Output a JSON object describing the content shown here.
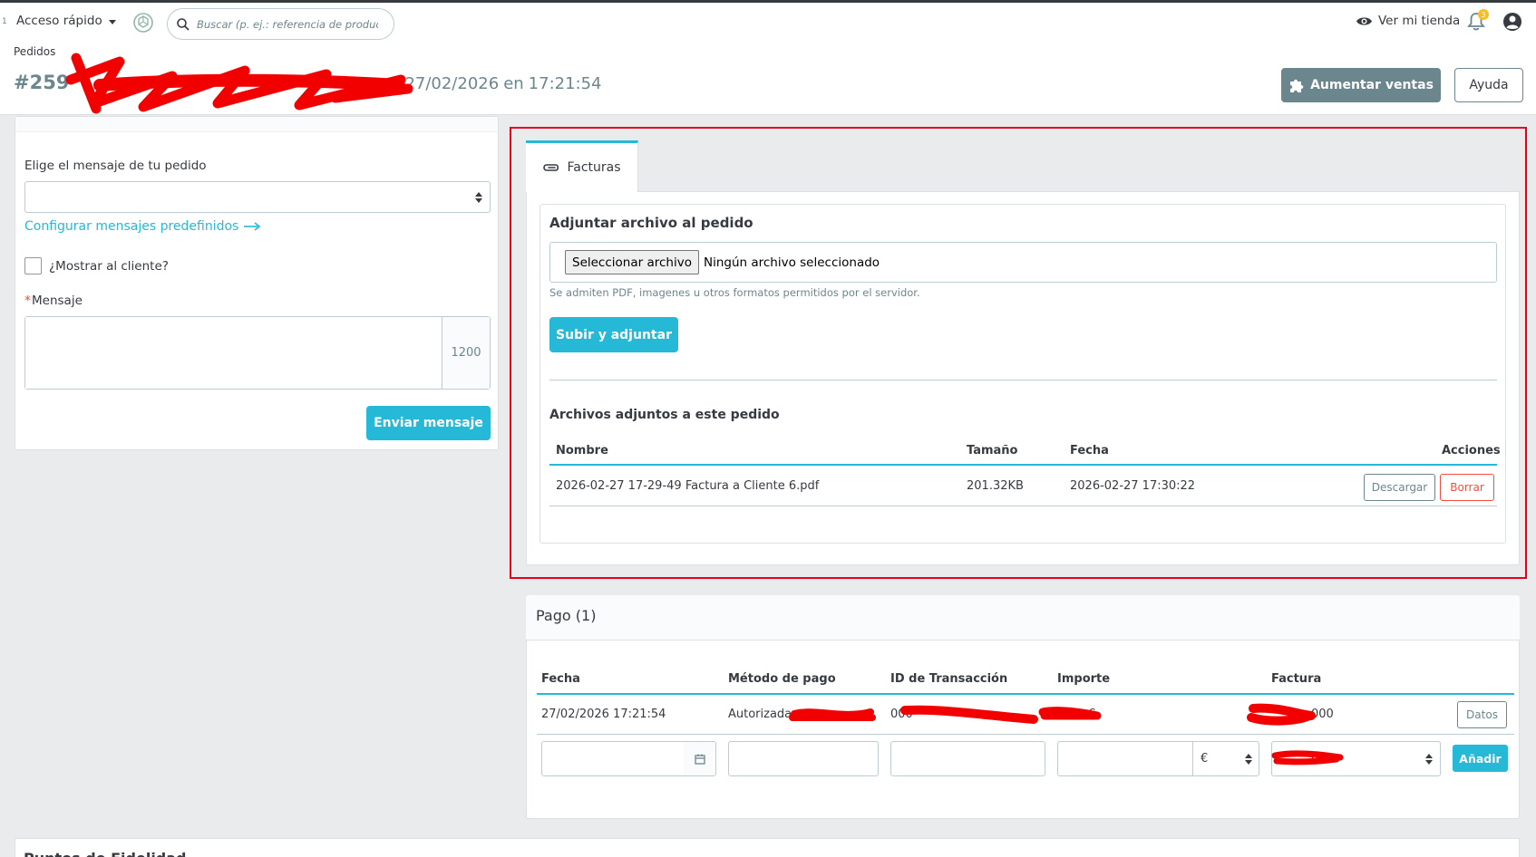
{
  "header": {
    "number_one": "1",
    "quick_access": "Acceso rápido",
    "search_placeholder": "Buscar (p. ej.: referencia de producto,",
    "view_store": "Ver mi tienda",
    "notification_count": "3"
  },
  "breadcrumb": "Pedidos",
  "order": {
    "number": "#259",
    "date": "27/02/2026",
    "at": "en",
    "time": "17:21:54"
  },
  "toolbar": {
    "grow_sales": "Aumentar ventas",
    "help": "Ayuda"
  },
  "messages": {
    "choose_label": "Elige el mensaje de tu pedido",
    "config_link": "Configurar mensajes predefinidos",
    "show_customer": "¿Mostrar al cliente?",
    "required_mark": "*",
    "message_label": "Mensaje",
    "char_count": "1200",
    "send_button": "Enviar mensaje"
  },
  "attachments": {
    "tab_label": "Facturas",
    "title": "Adjuntar archivo al pedido",
    "file_button": "Seleccionar archivo",
    "file_none": "Ningún archivo seleccionado",
    "help": "Se admiten PDF, imagenes u otros formatos permitidos por el servidor.",
    "upload_button": "Subir y adjuntar",
    "list_title": "Archivos adjuntos a este pedido",
    "columns": [
      "Nombre",
      "Tamaño",
      "Fecha",
      "Acciones"
    ],
    "rows": [
      {
        "name": "2026-02-27 17-29-49 Factura a Cliente 6.pdf",
        "size": "201.32KB",
        "date": "2026-02-27 17:30:22"
      }
    ],
    "download_button": "Descargar",
    "delete_button": "Borrar"
  },
  "payment": {
    "title": "Pago (1)",
    "columns": [
      "Fecha",
      "Método de pago",
      "ID de Transacción",
      "Importe",
      "Factura"
    ],
    "row": {
      "date": "27/02/2026 17:21:54",
      "method": "Autorizada",
      "transaction": "000",
      "amount": "€",
      "invoice": "000"
    },
    "details_button": "Datos",
    "currency": "€",
    "invoice_select": "0",
    "add_button": "Añadir"
  },
  "loyalty": {
    "title": "Puntos de Fidelidad"
  },
  "colors": {
    "primary": "#25b9d7",
    "secondary": "#6c868e",
    "danger": "#f54c3e",
    "highlight": "#e2001a",
    "background": "#eaebec"
  }
}
